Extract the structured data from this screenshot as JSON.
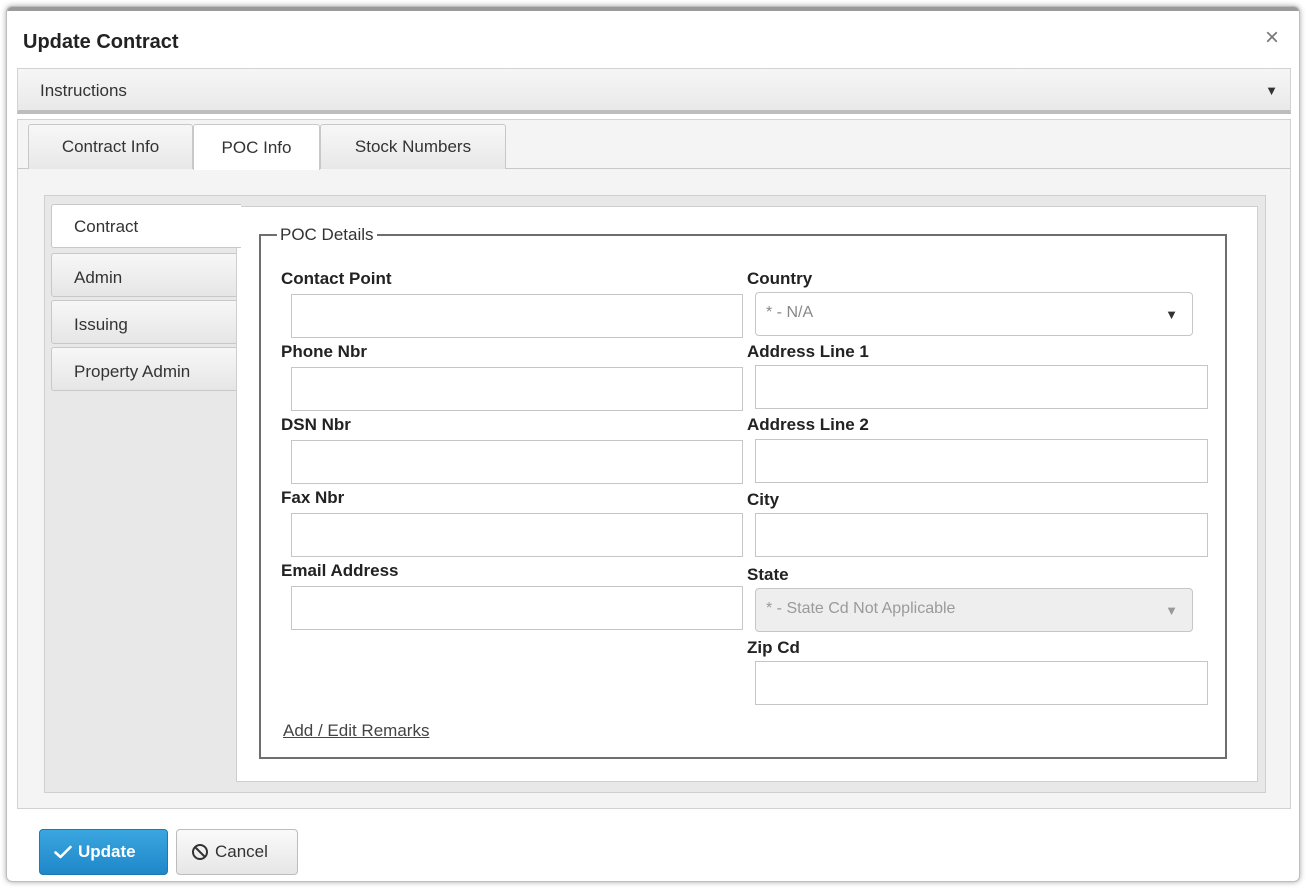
{
  "dialog": {
    "title": "Update Contract",
    "close_glyph": "×"
  },
  "instructions": {
    "label": "Instructions",
    "caret": "▼"
  },
  "tabs": [
    {
      "label": "Contract Info",
      "active": false
    },
    {
      "label": "POC Info",
      "active": true
    },
    {
      "label": "Stock Numbers",
      "active": false
    }
  ],
  "side_tabs": [
    {
      "label": "Contract",
      "active": true
    },
    {
      "label": "Admin",
      "active": false
    },
    {
      "label": "Issuing",
      "active": false
    },
    {
      "label": "Property Admin",
      "active": false
    }
  ],
  "poc": {
    "legend": "POC Details",
    "contact_point": {
      "label": "Contact Point",
      "value": ""
    },
    "phone_nbr": {
      "label": "Phone Nbr",
      "value": ""
    },
    "dsn_nbr": {
      "label": "DSN Nbr",
      "value": ""
    },
    "fax_nbr": {
      "label": "Fax Nbr",
      "value": ""
    },
    "email_address": {
      "label": "Email Address",
      "value": ""
    },
    "country": {
      "label": "Country",
      "selected": "* - N/A",
      "arrow": "▼"
    },
    "address_line_1": {
      "label": "Address Line 1",
      "value": ""
    },
    "address_line_2": {
      "label": "Address Line 2",
      "value": ""
    },
    "city": {
      "label": "City",
      "value": ""
    },
    "state": {
      "label": "State",
      "selected": "* - State Cd Not Applicable",
      "arrow": "▼",
      "disabled": true
    },
    "zip_cd": {
      "label": "Zip Cd",
      "value": ""
    },
    "remarks_link": "Add / Edit Remarks"
  },
  "buttons": {
    "update": {
      "label": "Update",
      "icon": "check-icon"
    },
    "cancel": {
      "label": "Cancel",
      "icon": "ban-icon"
    }
  },
  "colors": {
    "accent": "#1f87c9",
    "border": "#c6c6c6",
    "panel": "#e8e8e8"
  }
}
